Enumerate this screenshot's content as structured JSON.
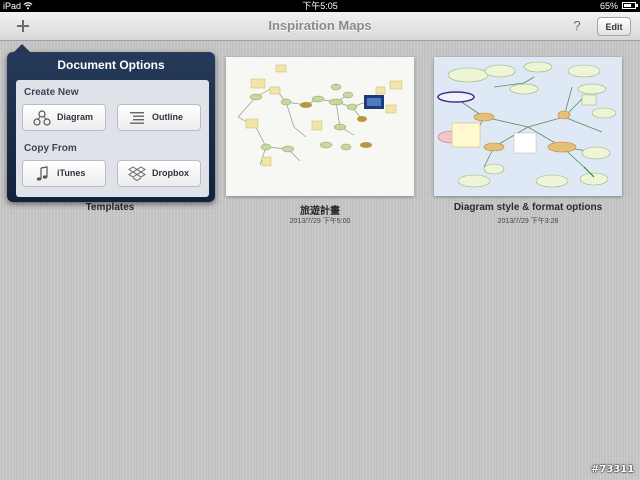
{
  "status_bar": {
    "carrier": "iPad",
    "time": "下午5:05",
    "battery": "65%"
  },
  "nav": {
    "title": "Inspiration Maps",
    "add_icon": "plus-icon",
    "help_label": "?",
    "edit_label": "Edit"
  },
  "popover": {
    "title": "Document Options",
    "create_new_label": "Create New",
    "copy_from_label": "Copy From",
    "buttons": [
      {
        "label": "Diagram",
        "icon": "diagram-icon"
      },
      {
        "label": "Outline",
        "icon": "outline-icon"
      },
      {
        "label": "iTunes",
        "icon": "music-note-icon"
      },
      {
        "label": "Dropbox",
        "icon": "dropbox-icon"
      }
    ]
  },
  "documents": [
    {
      "title": "Templates",
      "date": ""
    },
    {
      "title": "旅遊計畫",
      "date": "2013/7/29 下午5:00"
    },
    {
      "title": "Diagram style & format options",
      "date": "2013/7/29 下午3:28"
    }
  ],
  "watermark": "#73311",
  "colors": {
    "popover_bg": "#1b2c48",
    "popover_body": "#dfe3e9",
    "background": "#c9c9c9"
  }
}
